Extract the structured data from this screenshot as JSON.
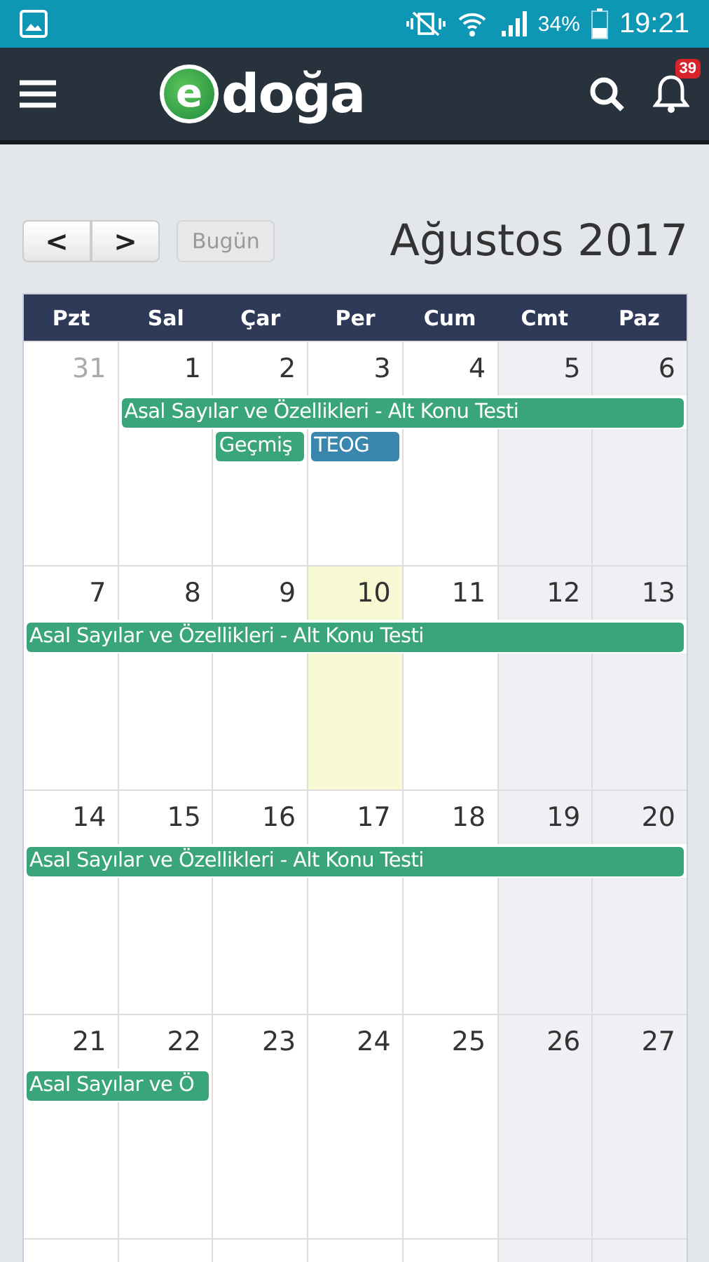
{
  "status_bar": {
    "battery": "34%",
    "time": "19:21"
  },
  "app_bar": {
    "logo": {
      "mark": "e",
      "text": "doğa"
    },
    "notification_count": "39"
  },
  "toolbar": {
    "prev": "<",
    "next": ">",
    "today": {
      "label": "Bugün",
      "disabled": true
    },
    "title": "Ağustos 2017"
  },
  "calendar": {
    "weekdays": [
      {
        "label": "Pzt",
        "weekend": false
      },
      {
        "label": "Sal",
        "weekend": false
      },
      {
        "label": "Çar",
        "weekend": false
      },
      {
        "label": "Per",
        "weekend": false
      },
      {
        "label": "Cum",
        "weekend": false
      },
      {
        "label": "Cmt",
        "weekend": true
      },
      {
        "label": "Paz",
        "weekend": true
      }
    ],
    "weeks": [
      {
        "days": [
          {
            "day": "31",
            "other_month": true,
            "today": false
          },
          {
            "day": "1",
            "other_month": false,
            "today": false
          },
          {
            "day": "2",
            "other_month": false,
            "today": false
          },
          {
            "day": "3",
            "other_month": false,
            "today": false
          },
          {
            "day": "4",
            "other_month": false,
            "today": false
          },
          {
            "day": "5",
            "other_month": false,
            "today": false
          },
          {
            "day": "6",
            "other_month": false,
            "today": false
          }
        ],
        "events": [
          {
            "title": "Asal Sayılar ve Özellikleri - Alt Konu Testi",
            "color": "#3aa57a"
          },
          {
            "title": "Geçmiş",
            "color": "#3aa57a"
          },
          {
            "title": "TEOG",
            "color": "#3a87ad"
          }
        ]
      },
      {
        "days": [
          {
            "day": "7",
            "other_month": false,
            "today": false
          },
          {
            "day": "8",
            "other_month": false,
            "today": false
          },
          {
            "day": "9",
            "other_month": false,
            "today": false
          },
          {
            "day": "10",
            "other_month": false,
            "today": true
          },
          {
            "day": "11",
            "other_month": false,
            "today": false
          },
          {
            "day": "12",
            "other_month": false,
            "today": false
          },
          {
            "day": "13",
            "other_month": false,
            "today": false
          }
        ],
        "events": [
          {
            "title": "Asal Sayılar ve Özellikleri - Alt Konu Testi",
            "color": "#3aa57a"
          }
        ]
      },
      {
        "days": [
          {
            "day": "14",
            "other_month": false,
            "today": false
          },
          {
            "day": "15",
            "other_month": false,
            "today": false
          },
          {
            "day": "16",
            "other_month": false,
            "today": false
          },
          {
            "day": "17",
            "other_month": false,
            "today": false
          },
          {
            "day": "18",
            "other_month": false,
            "today": false
          },
          {
            "day": "19",
            "other_month": false,
            "today": false
          },
          {
            "day": "20",
            "other_month": false,
            "today": false
          }
        ],
        "events": [
          {
            "title": "Asal Sayılar ve Özellikleri - Alt Konu Testi",
            "color": "#3aa57a"
          }
        ]
      },
      {
        "days": [
          {
            "day": "21",
            "other_month": false,
            "today": false
          },
          {
            "day": "22",
            "other_month": false,
            "today": false
          },
          {
            "day": "23",
            "other_month": false,
            "today": false
          },
          {
            "day": "24",
            "other_month": false,
            "today": false
          },
          {
            "day": "25",
            "other_month": false,
            "today": false
          },
          {
            "day": "26",
            "other_month": false,
            "today": false
          },
          {
            "day": "27",
            "other_month": false,
            "today": false
          }
        ],
        "events": [
          {
            "title": "Asal Sayılar ve Ö",
            "color": "#3aa57a"
          }
        ]
      }
    ]
  }
}
